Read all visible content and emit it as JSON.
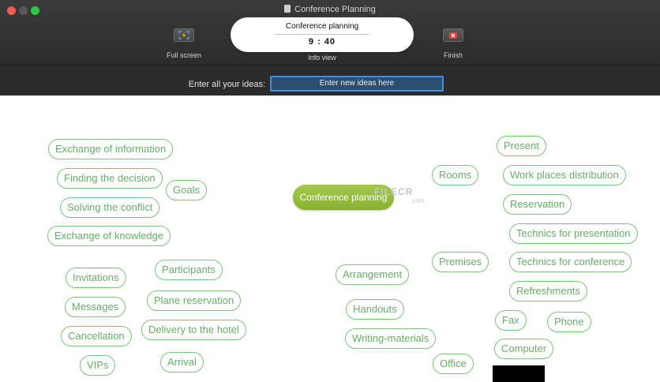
{
  "window": {
    "title": "Conference Planning"
  },
  "toolbar": {
    "fullscreen_label": "Full screen",
    "info_view_label": "Info view",
    "finish_label": "Finish",
    "info_title": "Conference planning",
    "timer": "9 : 40"
  },
  "input_bar": {
    "label": "Enter all your ideas:",
    "placeholder": "Enter new ideas here"
  },
  "mindmap": {
    "central": "Conference planning",
    "watermark": "FILECR",
    "watermark_sub": ".com",
    "ideas": [
      "Exchange of information",
      "Finding the decision",
      "Goals",
      "Solving the conflict",
      "Exchange of knowledge",
      "Invitations",
      "Participants",
      "Messages",
      "Plane reservation",
      "Cancellation",
      "Delivery to the hotel",
      "VIPs",
      "Arrival",
      "Rooms",
      "Present",
      "Work places distribution",
      "Reservation",
      "Technics for presentation",
      "Premises",
      "Technics for conference",
      "Arrangement",
      "Refreshments",
      "Handouts",
      "Fax",
      "Phone",
      "Writing-materials",
      "Computer",
      "Office"
    ]
  },
  "colors": {
    "node_border": "#7cc47a",
    "node_text": "#6aad6a",
    "central_fill": "#94bd3c",
    "toolbar_bg": "#2f2f2f",
    "input_focus": "#4a8ad6"
  }
}
